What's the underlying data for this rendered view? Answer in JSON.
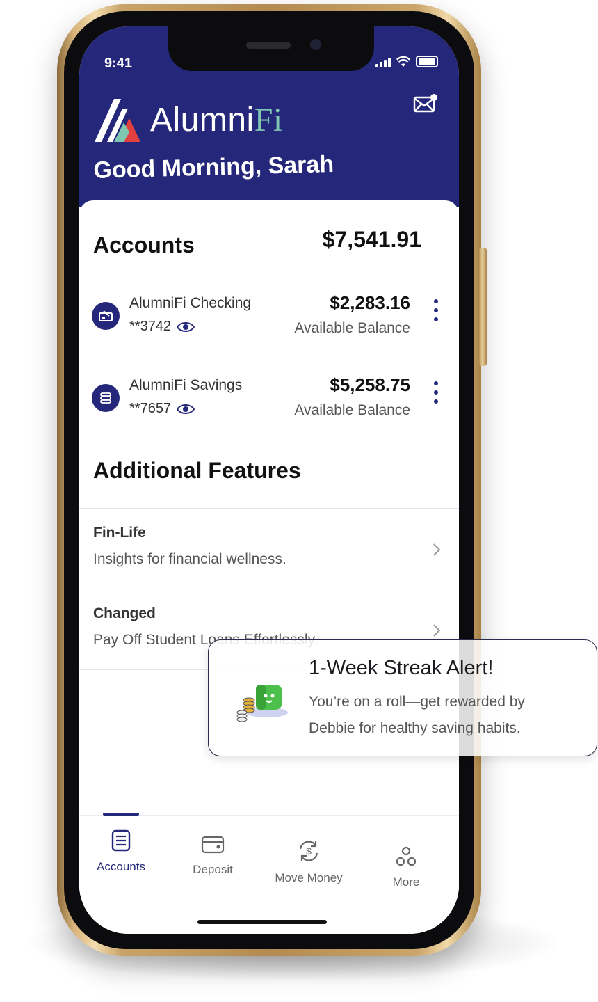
{
  "status_bar": {
    "time": "9:41"
  },
  "header": {
    "brand": {
      "name_main": "Alumni",
      "name_accent": "Fi"
    },
    "greeting": "Good Morning, Sarah",
    "mail_icon": "mail-notification-icon"
  },
  "accounts": {
    "title": "Accounts",
    "total": "$7,541.91",
    "items": [
      {
        "name": "AlumniFi Checking",
        "number": "**3742",
        "balance": "$2,283.16",
        "balance_label": "Available Balance",
        "icon": "check-icon"
      },
      {
        "name": "AlumniFi Savings",
        "number": "**7657",
        "balance": "$5,258.75",
        "balance_label": "Available Balance",
        "icon": "savings-coins-icon"
      }
    ]
  },
  "features": {
    "title": "Additional Features",
    "items": [
      {
        "title": "Fin-Life",
        "description": "Insights for financial wellness."
      },
      {
        "title": "Changed",
        "description": "Pay Off Student Loans Effortlessly."
      }
    ]
  },
  "tabbar": {
    "active": "Accounts",
    "tabs": [
      {
        "label": "Accounts",
        "icon": "list-document-icon"
      },
      {
        "label": "Deposit",
        "icon": "wallet-card-icon"
      },
      {
        "label": "Move Money",
        "icon": "transfer-dollar-icon"
      },
      {
        "label": "More",
        "icon": "more-circles-icon"
      }
    ]
  },
  "toast": {
    "title": "1-Week Streak Alert!",
    "body": "You’re on a roll—get rewarded by Debbie for healthy saving habits.",
    "icon": "coins-debbie-mascot-icon"
  },
  "colors": {
    "brand_navy": "#24277A",
    "logo_accent": "#7FC7B3",
    "logo_red": "#E0413F",
    "mascot_green": "#4CC04A",
    "coin_gold": "#E3B23C"
  }
}
